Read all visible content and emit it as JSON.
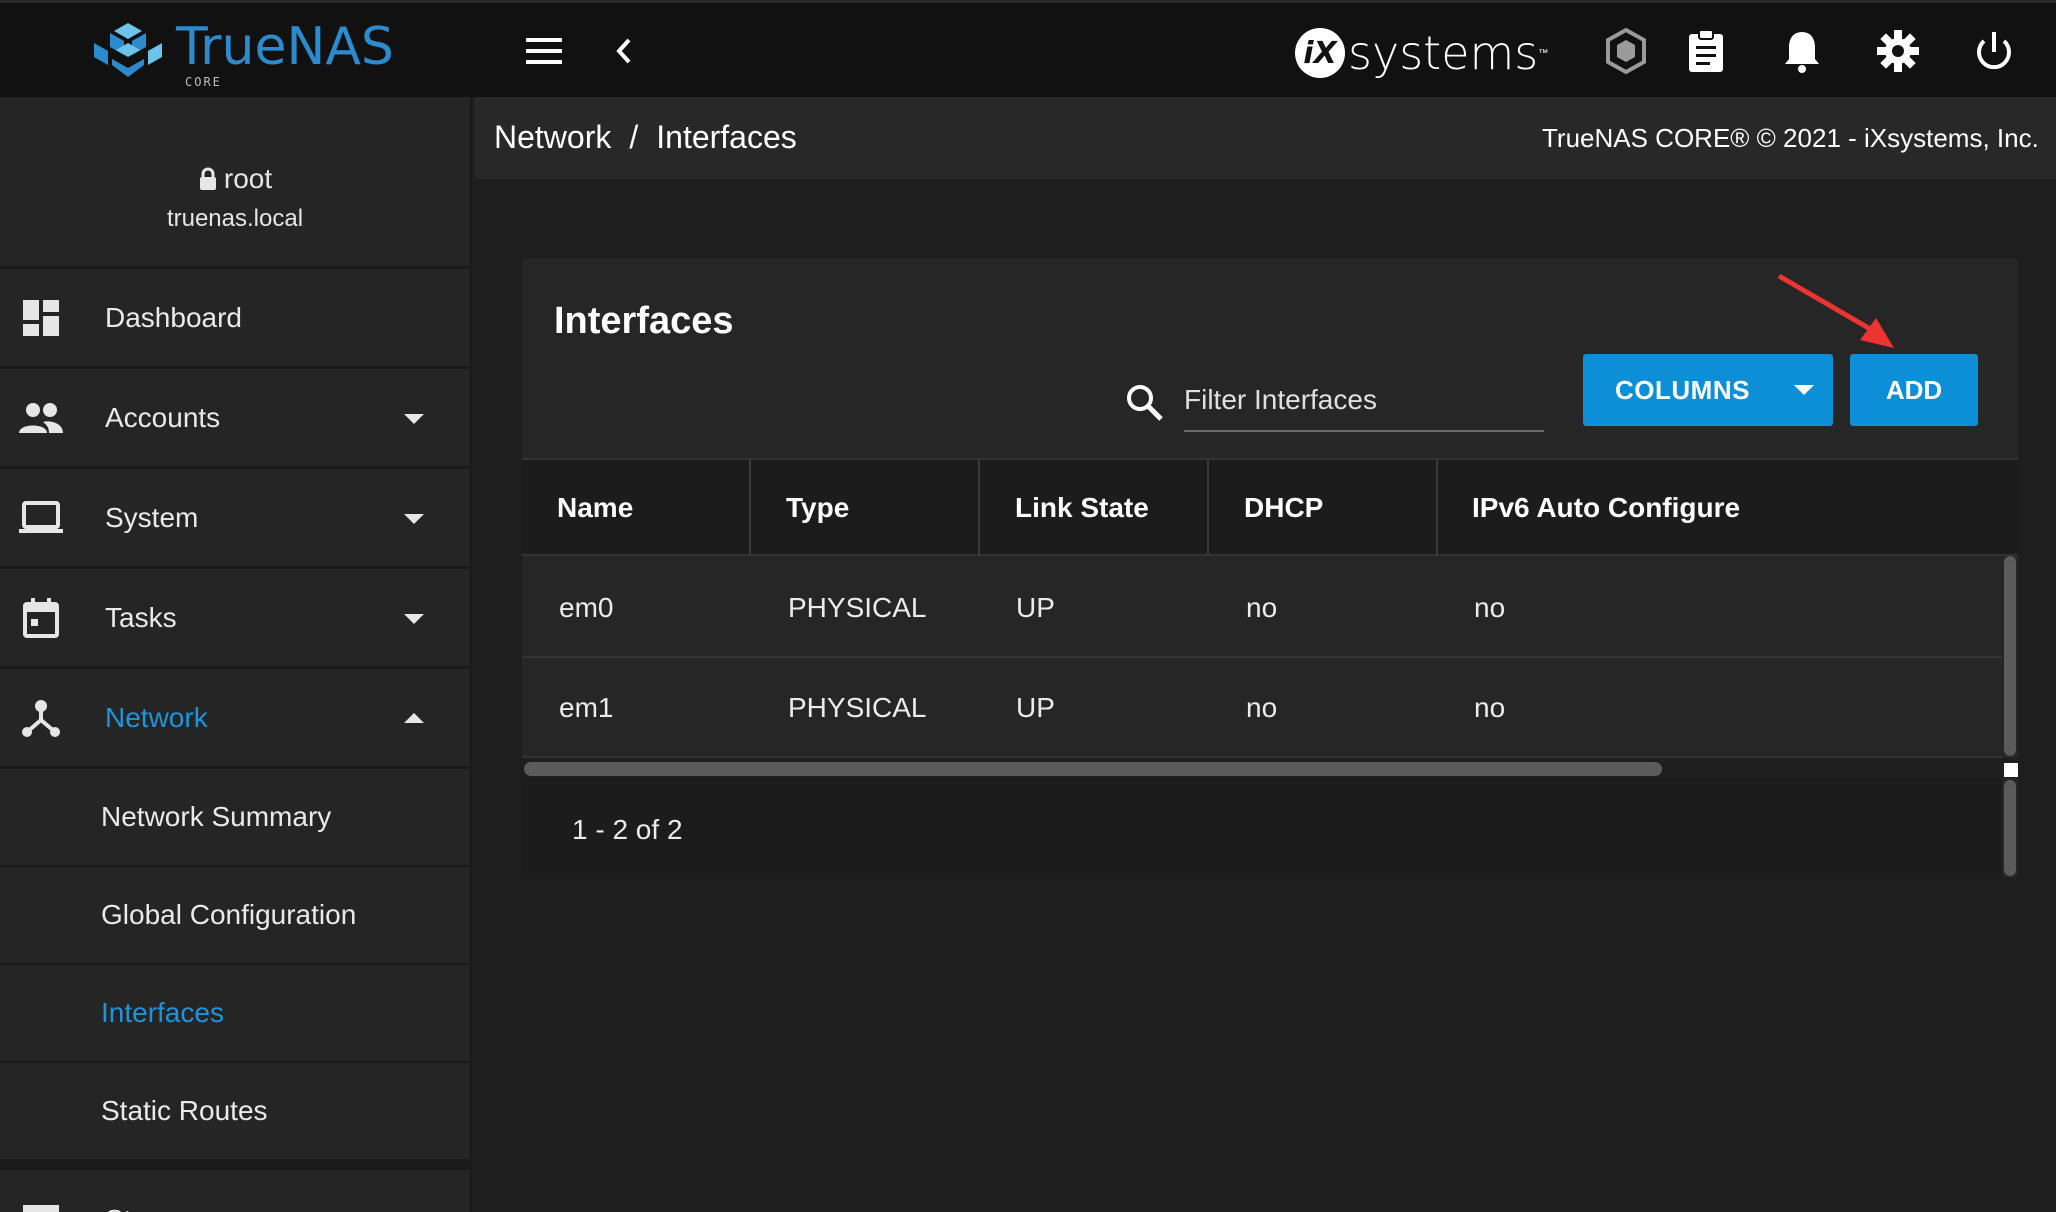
{
  "app": {
    "brand": "TrueNAS",
    "edition": "CORE",
    "vendor_logo": "systems",
    "vendor_logo_badge": "iX",
    "accent_color": "#0d8fd8",
    "active_color": "#1f93dc"
  },
  "topbar": {
    "icons": [
      "menu-icon",
      "chevron-left-icon",
      "truecommand-icon",
      "clipboard-icon",
      "bell-icon",
      "gear-icon",
      "power-icon"
    ]
  },
  "user": {
    "name": "root",
    "host": "truenas.local"
  },
  "sidebar": {
    "items": [
      {
        "label": "Dashboard",
        "icon": "dashboard-icon"
      },
      {
        "label": "Accounts",
        "icon": "people-icon"
      },
      {
        "label": "System",
        "icon": "laptop-icon"
      },
      {
        "label": "Tasks",
        "icon": "calendar-icon"
      },
      {
        "label": "Network",
        "icon": "network-icon"
      }
    ],
    "network_sub": [
      {
        "label": "Network Summary"
      },
      {
        "label": "Global Configuration"
      },
      {
        "label": "Interfaces"
      },
      {
        "label": "Static Routes"
      }
    ],
    "next_item": {
      "label": "Storage",
      "icon": "storage-icon"
    }
  },
  "breadcrumb": {
    "parent": "Network",
    "separator": "/",
    "current": "Interfaces"
  },
  "copyright": "TrueNAS CORE® © 2021 - iXsystems, Inc.",
  "card": {
    "title": "Interfaces",
    "filter_placeholder": "Filter Interfaces",
    "columns_button": "COLUMNS",
    "add_button": "ADD",
    "columns": [
      "Name",
      "Type",
      "Link State",
      "DHCP",
      "IPv6 Auto Configure"
    ],
    "rows": [
      [
        "em0",
        "PHYSICAL",
        "UP",
        "no",
        "no"
      ],
      [
        "em1",
        "PHYSICAL",
        "UP",
        "no",
        "no"
      ]
    ],
    "paginator": "1 - 2 of 2"
  }
}
